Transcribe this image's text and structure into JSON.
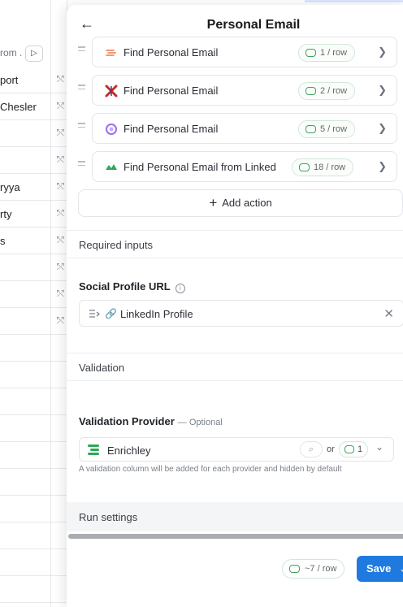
{
  "background": {
    "header_text": "rom .",
    "play_glyph": "▷",
    "cells": [
      "port",
      "Chesler",
      "",
      "",
      "ryya",
      "rty",
      "s"
    ],
    "icon_glyph": "⤲"
  },
  "panel": {
    "back_glyph": "←",
    "title": "Personal Email"
  },
  "actions": [
    {
      "label": "Find Personal Email",
      "credits": "1 / row"
    },
    {
      "label": "Find Personal Email",
      "credits": "2 / row"
    },
    {
      "label": "Find Personal Email",
      "credits": "5 / row"
    },
    {
      "label": "Find Personal Email from Linked",
      "credits": "18 / row"
    }
  ],
  "add_action": {
    "plus": "+",
    "label": "Add action"
  },
  "required_inputs": {
    "section_label": "Required inputs"
  },
  "social_profile": {
    "label": "Social Profile URL",
    "info_glyph": "i",
    "value": "LinkedIn Profile",
    "clear_glyph": "✕"
  },
  "validation": {
    "section_label": "Validation",
    "provider_label": "Validation Provider",
    "optional_text": "— Optional",
    "provider_name": "Enrichley",
    "search_glyph": "⌕",
    "or_text": "or",
    "credit_value": "1",
    "chevron_glyph": "⌄",
    "help_text": "A validation column will be added for each provider and hidden by default"
  },
  "run_settings": {
    "label": "Run settings"
  },
  "footer": {
    "estimate": "~7 / row",
    "save_label": "Save",
    "save_chevron": "⌄"
  },
  "colors": {
    "accent": "#1f7ae0",
    "credit_green": "#3aa55d",
    "enrichley_green": "#2fa75a"
  }
}
